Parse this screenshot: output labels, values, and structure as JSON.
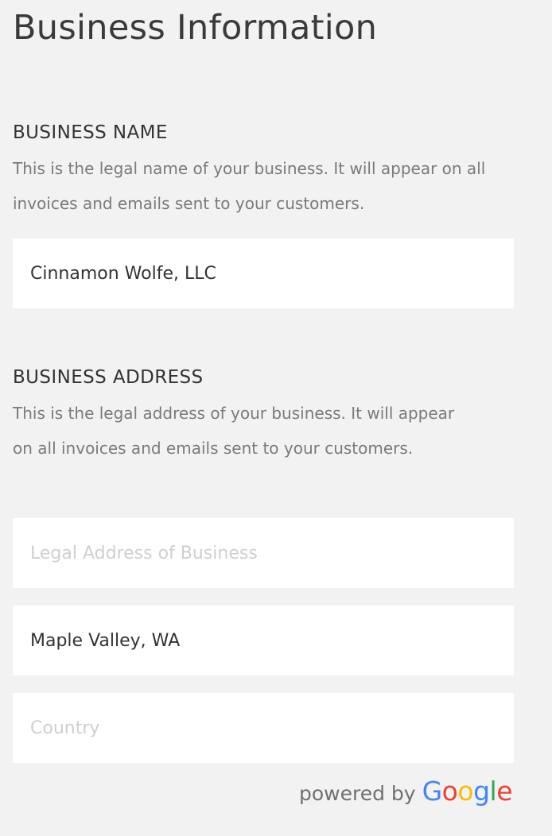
{
  "page": {
    "title": "Business Information"
  },
  "business_name": {
    "label": "BUSINESS NAME",
    "description": "This is the legal name of your business. It will appear on all invoices and emails sent to your customers.",
    "value": "Cinnamon Wolfe, LLC"
  },
  "business_address": {
    "label": "BUSINESS ADDRESS",
    "description": "This is the legal address of your business. It will appear on all invoices and emails sent to your customers.",
    "address_field": {
      "value": "",
      "placeholder": "Legal Address of Business"
    },
    "city_state_field": {
      "value": "Maple Valley, WA"
    },
    "country_field": {
      "value": "",
      "placeholder": "Country"
    }
  },
  "attribution": {
    "powered_text": "powered by",
    "logo_letters": [
      "G",
      "o",
      "o",
      "g",
      "l",
      "e"
    ],
    "logo_colors": [
      "#4285f4",
      "#ea4335",
      "#fbbc05",
      "#4285f4",
      "#34a853",
      "#ea4335"
    ]
  }
}
